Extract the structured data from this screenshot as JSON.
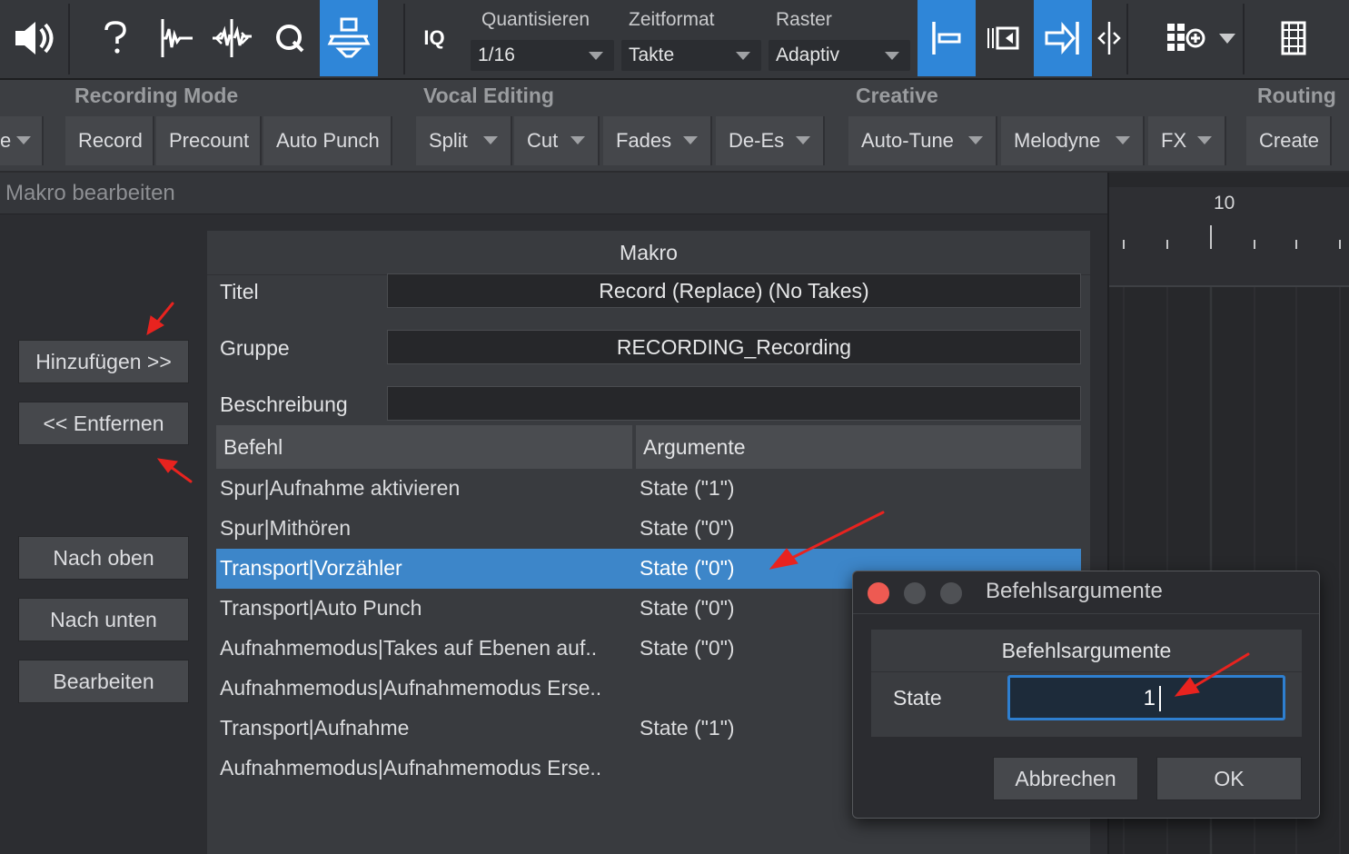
{
  "toolbar": {
    "icons": [
      "speaker-icon",
      "help-icon",
      "audio-bend-icon",
      "audio-split-icon",
      "quantize-icon",
      "loop-print-icon",
      "iq-icon"
    ],
    "iq_label": "IQ",
    "quantize_label": "Quantisieren",
    "quantize_value": "1/16",
    "timeformat_label": "Zeitformat",
    "timeformat_value": "Takte",
    "grid_label": "Raster",
    "grid_value": "Adaptiv",
    "right_icons": [
      "snap-start-icon",
      "scroll-icon",
      "follow-icon",
      "split-cursor-icon",
      "grid-add-icon",
      "film-icon"
    ],
    "accent": "#2f86d8"
  },
  "macrobar": {
    "groups": {
      "recording": "Recording Mode",
      "vocal": "Vocal Editing",
      "creative": "Creative",
      "routing": "Routing"
    },
    "buttons": {
      "partial": "e",
      "record": "Record",
      "precount": "Precount",
      "autopunch": "Auto Punch",
      "split": "Split",
      "cut": "Cut",
      "fades": "Fades",
      "dees": "De-Es",
      "autotune": "Auto-Tune",
      "melodyne": "Melodyne",
      "fx": "FX",
      "create": "Create"
    }
  },
  "editor": {
    "title": "Makro bearbeiten",
    "buttons": {
      "add": "Hinzufügen >>",
      "remove": "<< Entfernen",
      "up": "Nach oben",
      "down": "Nach unten",
      "edit": "Bearbeiten"
    },
    "panel": {
      "header": "Makro",
      "title_label": "Titel",
      "title_value": "Record (Replace) (No Takes)",
      "group_label": "Gruppe",
      "group_value": "RECORDING_Recording",
      "desc_label": "Beschreibung",
      "desc_value": "",
      "col_command": "Befehl",
      "col_args": "Argumente",
      "rows": [
        {
          "cmd": "Spur|Aufnahme aktivieren",
          "arg": "State (\"1\")"
        },
        {
          "cmd": "Spur|Mithören",
          "arg": "State (\"0\")"
        },
        {
          "cmd": "Transport|Vorzähler",
          "arg": "State (\"0\")"
        },
        {
          "cmd": "Transport|Auto Punch",
          "arg": "State (\"0\")"
        },
        {
          "cmd": "Aufnahmemodus|Takes auf Ebenen auf..",
          "arg": "State (\"0\")"
        },
        {
          "cmd": "Aufnahmemodus|Aufnahmemodus Erse..",
          "arg": ""
        },
        {
          "cmd": "Transport|Aufnahme",
          "arg": "State (\"1\")"
        },
        {
          "cmd": "Aufnahmemodus|Aufnahmemodus Erse..",
          "arg": ""
        }
      ],
      "selected_row": 2
    }
  },
  "timeline": {
    "bar_label": "10"
  },
  "dialog": {
    "title": "Befehlsargumente",
    "header": "Befehlsargumente",
    "state_label": "State",
    "state_value": "1",
    "cancel": "Abbrechen",
    "ok": "OK"
  },
  "annotation_color": "#e8231f"
}
